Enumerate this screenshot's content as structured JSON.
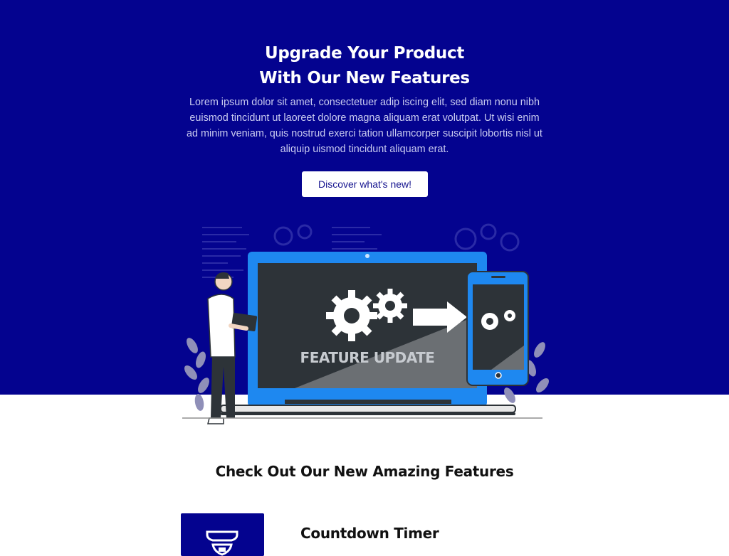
{
  "hero": {
    "title_line1": "Upgrade Your Product",
    "title_line2": "With Our New Features",
    "text": "Lorem ipsum dolor sit amet, consectetuer adip iscing elit, sed diam nonu nibh euismod tincidunt ut laoreet dolore magna aliquam erat volutpat. Ut wisi enim ad minim veniam, quis nostrud exerci tation ullamcorper suscipit lobortis nisl ut aliquip uismod tincidunt aliquam erat.",
    "cta_label": "Discover what's new!"
  },
  "illustration": {
    "screen_caption": "FEATURE UPDATE",
    "icons": [
      "gears-icon",
      "arrow-right-icon",
      "laptop-icon",
      "tablet-icon",
      "person-icon",
      "plant-icon"
    ]
  },
  "features": {
    "section_title": "Check Out Our New Amazing Features",
    "items": [
      {
        "title": "Countdown Timer",
        "icon": "timer-icon"
      }
    ]
  },
  "colors": {
    "hero_background": "#04038f",
    "button_text": "#15148f",
    "laptop_blue": "#1e88f0",
    "screen_dark": "#2d3338"
  }
}
